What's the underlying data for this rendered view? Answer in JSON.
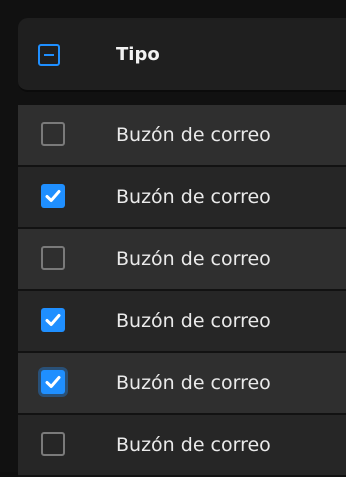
{
  "header": {
    "title": "Tipo",
    "select_all_state": "indeterminate"
  },
  "rows": [
    {
      "label": "Buzón de correo",
      "checked": false
    },
    {
      "label": "Buzón de correo",
      "checked": true
    },
    {
      "label": "Buzón de correo",
      "checked": false
    },
    {
      "label": "Buzón de correo",
      "checked": true
    },
    {
      "label": "Buzón de correo",
      "checked": true,
      "focused": true
    },
    {
      "label": "Buzón de correo",
      "checked": false
    }
  ],
  "colors": {
    "accent": "#1f8fff",
    "header_bg": "#1f1f1f",
    "row_bg_a": "#2f2f2f",
    "row_bg_b": "#262626",
    "text": "#eaeaea"
  }
}
